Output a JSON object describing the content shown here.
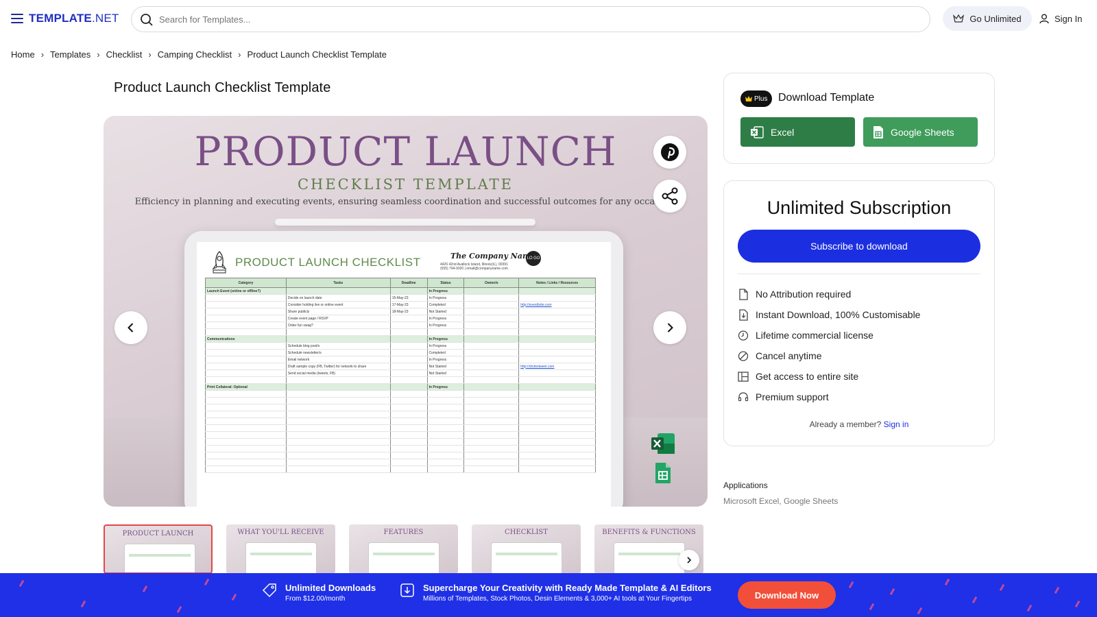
{
  "header": {
    "logo_bold": "TEMPLATE",
    "logo_net": ".NET",
    "search_placeholder": "Search for Templates...",
    "go_unlimited": "Go Unlimited",
    "sign_in": "Sign In"
  },
  "breadcrumb": [
    "Home",
    "Templates",
    "Checklist",
    "Camping Checklist",
    "Product Launch Checklist Template"
  ],
  "page_title": "Product Launch Checklist Template",
  "preview": {
    "title": "PRODUCT LAUNCH",
    "subtitle": "CHECKLIST TEMPLATE",
    "description": "Efficiency in planning and executing events, ensuring seamless coordination and successful outcomes for any occasion.",
    "sheet_title": "PRODUCT LAUNCH CHECKLIST",
    "company_name": "The Company Name",
    "company_address": "4426 42nd Avallock Island, Illinois(IL), 00391",
    "company_contact": "(555) 794-9320 | email@companyname.com",
    "logo_text": "LO GO",
    "columns": [
      "Category",
      "Tasks",
      "Deadline",
      "Status",
      "Owner/s",
      "Notes / Links / Resources"
    ],
    "rows": [
      {
        "category": "Launch Event (online or offline?)",
        "task": "",
        "deadline": "",
        "status": "In Progress",
        "owner": "",
        "notes": "",
        "section": true
      },
      {
        "category": "",
        "task": "Decide on launch date",
        "deadline": "15-May-23",
        "status": "In Progress",
        "owner": "",
        "notes": ""
      },
      {
        "category": "",
        "task": "Consider holding live or online event",
        "deadline": "17-May-23",
        "status": "Completed",
        "owner": "",
        "notes": "http://eventbrite.com"
      },
      {
        "category": "",
        "task": "Share publicly",
        "deadline": "18-May-23",
        "status": "Not Started",
        "owner": "",
        "notes": ""
      },
      {
        "category": "",
        "task": "Create event page / RSVP",
        "deadline": "",
        "status": "In Progress",
        "owner": "",
        "notes": ""
      },
      {
        "category": "",
        "task": "Order fun swag?",
        "deadline": "",
        "status": "In Progress",
        "owner": "",
        "notes": ""
      },
      {
        "category": "",
        "task": "",
        "deadline": "",
        "status": "",
        "owner": "",
        "notes": ""
      },
      {
        "category": "Communications",
        "task": "",
        "deadline": "",
        "status": "In Progress",
        "owner": "",
        "notes": "",
        "section": true
      },
      {
        "category": "",
        "task": "Schedule blog post/s",
        "deadline": "",
        "status": "In Progress",
        "owner": "",
        "notes": ""
      },
      {
        "category": "",
        "task": "Schedule newsletter/s",
        "deadline": "",
        "status": "Completed",
        "owner": "",
        "notes": ""
      },
      {
        "category": "",
        "task": "Email network",
        "deadline": "",
        "status": "In Progress",
        "owner": "",
        "notes": ""
      },
      {
        "category": "",
        "task": "Draft sample copy (FB, Twitter) for network to share",
        "deadline": "",
        "status": "Not Started",
        "owner": "",
        "notes": "http://clicktotweet.com"
      },
      {
        "category": "",
        "task": "Send social media (tweets, FB)",
        "deadline": "",
        "status": "Not Started",
        "owner": "",
        "notes": ""
      },
      {
        "category": "",
        "task": "",
        "deadline": "",
        "status": "",
        "owner": "",
        "notes": ""
      },
      {
        "category": "Print Collateral: Optional",
        "task": "",
        "deadline": "",
        "status": "In Progress",
        "owner": "",
        "notes": "",
        "section": true
      }
    ]
  },
  "thumbnails": [
    "PRODUCT LAUNCH",
    "WHAT YOU'LL RECEIVE",
    "FEATURES",
    "CHECKLIST",
    "BENEFITS & FUNCTIONS"
  ],
  "download": {
    "badge": "Plus",
    "title": "Download Template",
    "excel": "Excel",
    "google_sheets": "Google Sheets"
  },
  "subscription": {
    "title": "Unlimited Subscription",
    "button": "Subscribe to download",
    "features": [
      {
        "icon": "document-icon",
        "label": "No Attribution required"
      },
      {
        "icon": "download-file-icon",
        "label": "Instant Download, 100% Customisable"
      },
      {
        "icon": "clock-icon",
        "label": "Lifetime commercial license"
      },
      {
        "icon": "cancel-icon",
        "label": "Cancel anytime"
      },
      {
        "icon": "layout-icon",
        "label": "Get access to entire site"
      },
      {
        "icon": "headset-icon",
        "label": "Premium support"
      }
    ],
    "member_text": "Already a member?",
    "member_link": "Sign in"
  },
  "applications": {
    "label": "Applications",
    "value": "Microsoft Excel, Google Sheets"
  },
  "banner": {
    "item1_title": "Unlimited Downloads",
    "item1_sub": "From $12.00/month",
    "item2_title": "Supercharge Your Creativity with Ready Made Template & AI Editors",
    "item2_sub": "Millions of Templates, Stock Photos, Desin Elements & 3,000+ AI tools at Your Fingertips",
    "button": "Download Now"
  },
  "colors": {
    "brand_blue": "#1c2fe0",
    "excel_green": "#2e7d46",
    "sheets_green": "#3f9c5b",
    "cta_orange": "#f24f3a",
    "preview_purple": "#7a4f86"
  }
}
